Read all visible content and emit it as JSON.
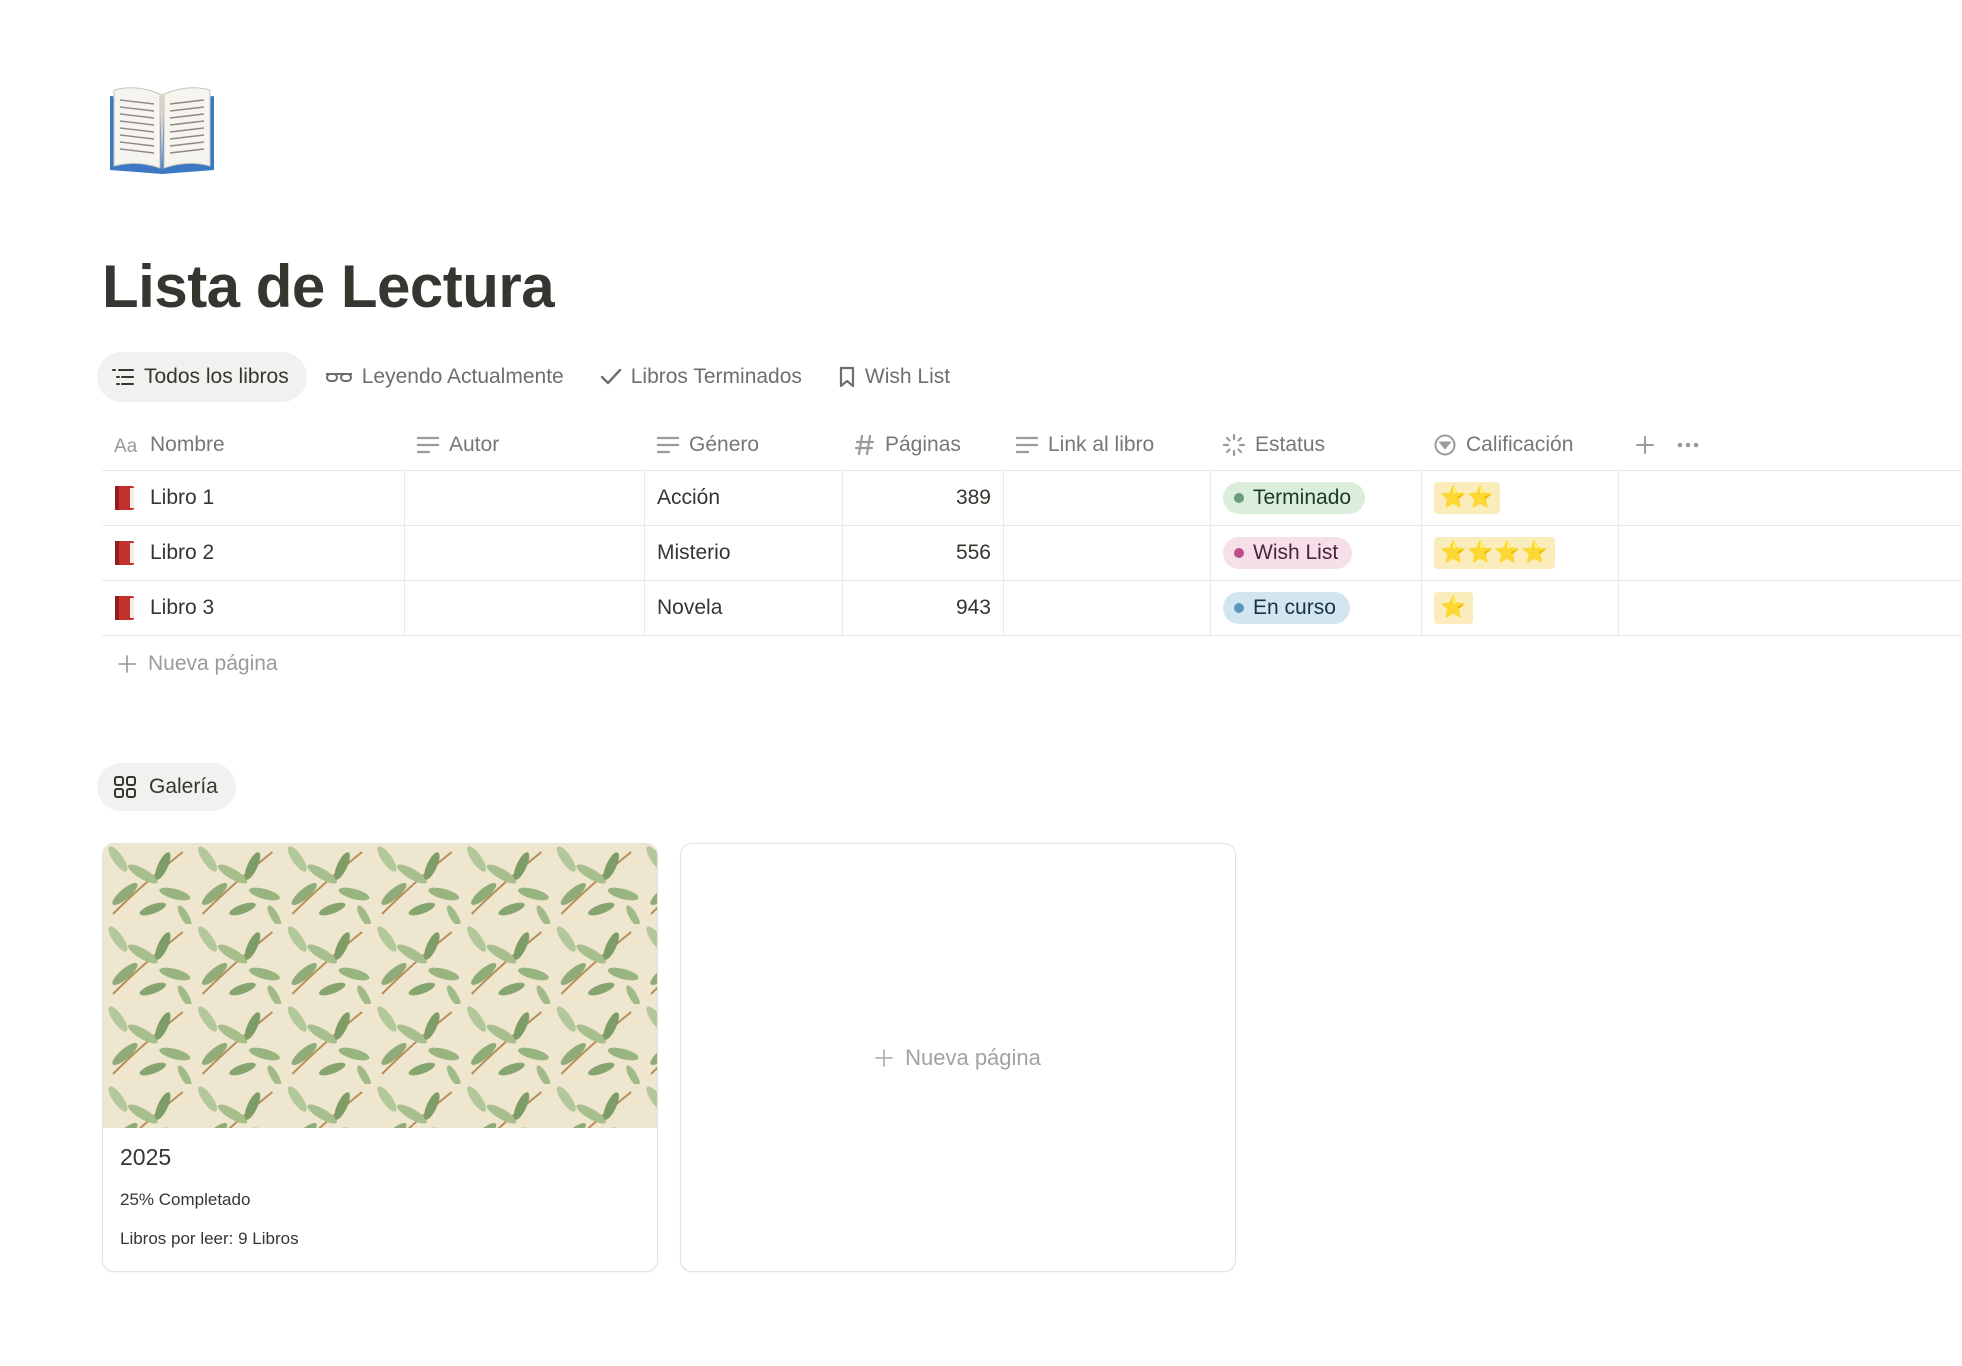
{
  "page": {
    "icon": "open-book-icon",
    "title": "Lista de Lectura"
  },
  "views": [
    {
      "label": "Todos los libros",
      "icon": "list-icon",
      "active": true
    },
    {
      "label": "Leyendo Actualmente",
      "icon": "glasses-icon",
      "active": false
    },
    {
      "label": "Libros Terminados",
      "icon": "checkmark-icon",
      "active": false
    },
    {
      "label": "Wish List",
      "icon": "bookmark-icon",
      "active": false
    }
  ],
  "table": {
    "columns": [
      {
        "label": "Nombre",
        "icon": "title-aa-icon"
      },
      {
        "label": "Autor",
        "icon": "text-lines-icon"
      },
      {
        "label": "Género",
        "icon": "text-lines-icon"
      },
      {
        "label": "Páginas",
        "icon": "hash-icon"
      },
      {
        "label": "Link al libro",
        "icon": "text-lines-icon"
      },
      {
        "label": "Estatus",
        "icon": "status-spinner-icon"
      },
      {
        "label": "Calificación",
        "icon": "select-circle-icon"
      }
    ],
    "rows": [
      {
        "icon": "red-book-icon",
        "nombre": "Libro 1",
        "autor": "",
        "genero": "Acción",
        "paginas": "389",
        "link": "",
        "estatus": "Terminado",
        "estatus_color": "#6c9b7d",
        "calificacion": "⭐⭐"
      },
      {
        "icon": "red-book-icon",
        "nombre": "Libro 2",
        "autor": "",
        "genero": "Misterio",
        "paginas": "556",
        "link": "",
        "estatus": "Wish List",
        "estatus_color": "#c14c8a",
        "calificacion": "⭐⭐⭐⭐"
      },
      {
        "icon": "red-book-icon",
        "nombre": "Libro 3",
        "autor": "",
        "genero": "Novela",
        "paginas": "943",
        "link": "",
        "estatus": "En curso",
        "estatus_color": "#5b97bd",
        "calificacion": "⭐"
      }
    ],
    "add_row_label": "Nueva página"
  },
  "gallery": {
    "tab_label": "Galería",
    "tab_icon": "gallery-grid-icon",
    "cards": [
      {
        "title": "2025",
        "progress": "25% Completado",
        "pending": "Libros por leer: 9 Libros",
        "cover": "willow-leaf-pattern"
      }
    ],
    "add_card_label": "Nueva página"
  }
}
